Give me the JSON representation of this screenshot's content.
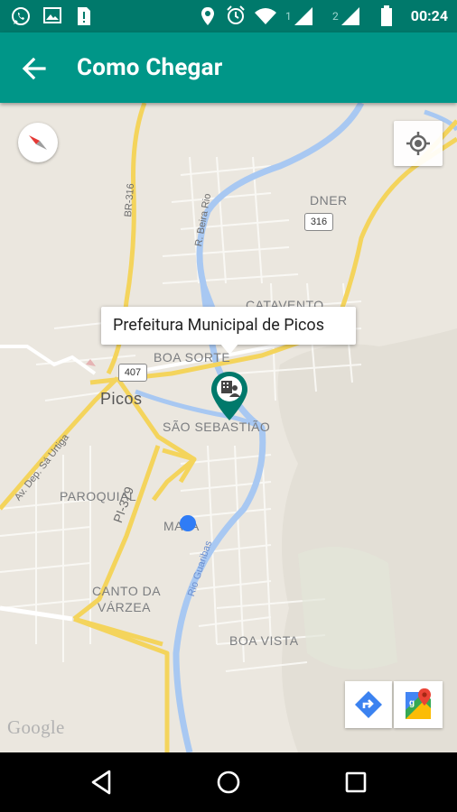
{
  "status_bar": {
    "time": "00:24",
    "left_icons": [
      "whatsapp-icon",
      "image-icon",
      "sim-alert-icon"
    ],
    "right_icons": [
      "location-icon",
      "alarm-icon",
      "wifi-icon",
      "signal-1-icon",
      "signal-2-icon",
      "battery-icon"
    ],
    "sim1_label": "1",
    "sim2_label": "2"
  },
  "app_bar": {
    "title": "Como Chegar",
    "back_icon": "arrow-back-icon",
    "color": "#009688"
  },
  "map": {
    "info_window": "Prefeitura Municipal de Picos",
    "labels": {
      "dner": "DNER",
      "catavento": "CATAVENTO",
      "boa_sorte": "BOA SORTE",
      "picos": "Picos",
      "sao_sebastiao": "SÃO SEBASTIÃO",
      "paroquial": "PAROQUIAL",
      "maria": "MA  IA",
      "canto_da": "CANTO DA",
      "varzea": "VÁRZEA",
      "boa_vista": "BOA VISTA",
      "pi379": "PI-379",
      "av_dep": "Av. Dep. Sá Urtiga",
      "r_beira_rio": "R. Beira Rio",
      "rio_guaribas": "Rio Guaribas",
      "br316_left": "BR-316"
    },
    "shields": {
      "s316": "316",
      "s407": "407"
    },
    "watermark": "Google",
    "accent_marker": "#00796b",
    "user_location_color": "#2f7cf6"
  },
  "controls": {
    "compass_icon": "compass-icon",
    "my_location_icon": "my-location-icon",
    "directions_icon": "directions-icon",
    "google_maps_icon": "google-maps-icon"
  },
  "nav_bar": {
    "back": "nav-back-icon",
    "home": "nav-home-icon",
    "recents": "nav-recents-icon"
  }
}
